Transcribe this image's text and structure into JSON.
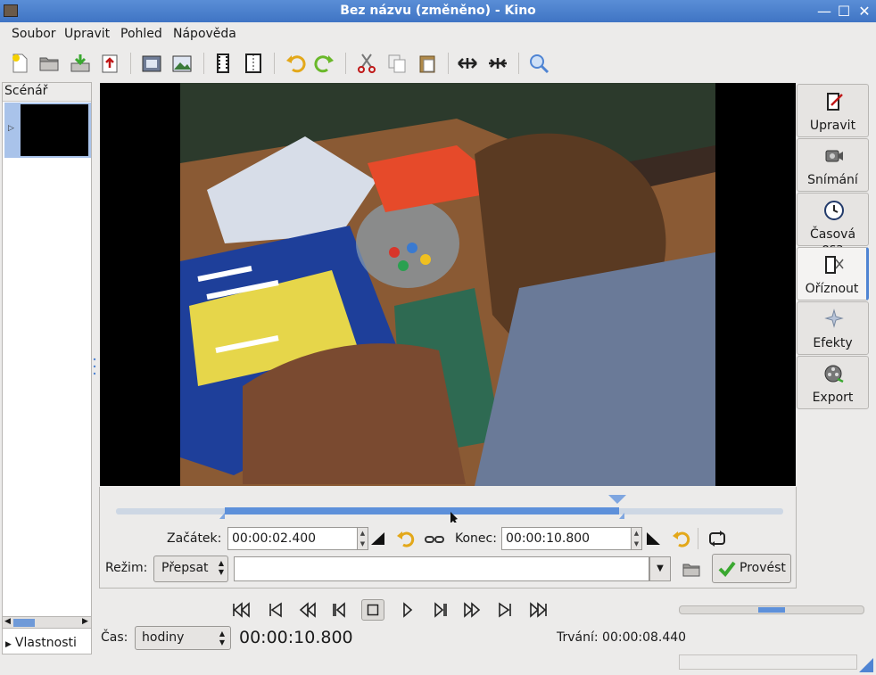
{
  "window": {
    "title": "Bez názvu (změněno)  - Kino",
    "min": "—",
    "max": "☐",
    "close": "✕"
  },
  "menu": [
    "Soubor",
    "Upravit",
    "Pohled",
    "Nápověda"
  ],
  "storyboard": {
    "header": "Scénář",
    "properties": "Vlastnosti"
  },
  "right_tabs": [
    "Upravit",
    "Snímání",
    "Časová osa",
    "Oříznout",
    "Efekty",
    "Export"
  ],
  "trim": {
    "start_label": "Začátek:",
    "start_value": "00:00:02.400",
    "end_label": "Konec:",
    "end_value": "00:00:10.800",
    "mode_label": "Režim:",
    "mode_value": "Přepsat",
    "file_value": "",
    "apply_label": "Provést"
  },
  "time": {
    "label": "Čas:",
    "unit": "hodiny",
    "current": "00:00:10.800",
    "duration": "Trvání: 00:00:08.440"
  },
  "colors": {
    "accent": "#4f84d3",
    "titlebar": "#4a80cf",
    "apply_check": "#3aa830"
  }
}
